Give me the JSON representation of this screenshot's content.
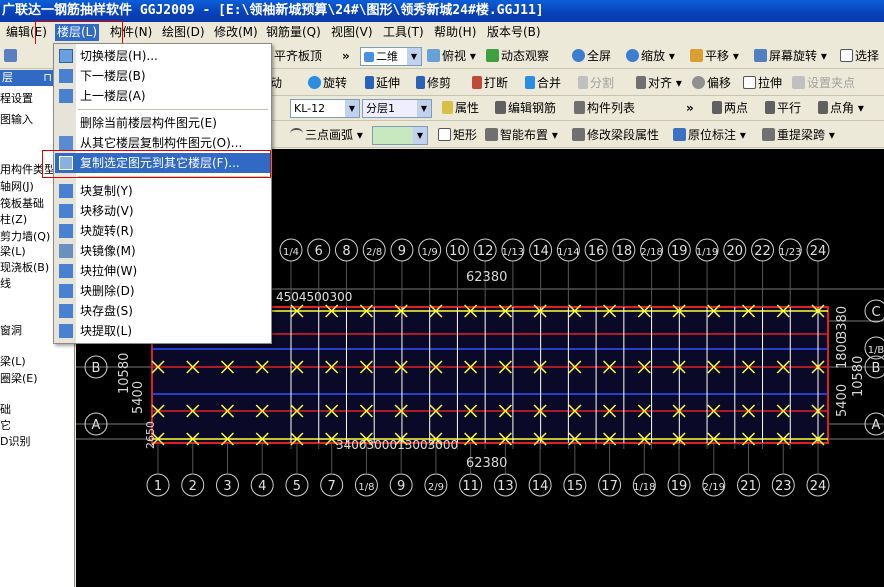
{
  "window": {
    "title": "广联达一钢筋抽样软件 GGJ2009 - [E:\\领袖新城预算\\24#\\图形\\领秀新城24#楼.GGJ11]"
  },
  "menubar": {
    "items": [
      "编辑(E)",
      "楼层(L)",
      "构件(N)",
      "绘图(D)",
      "修改(M)",
      "钢筋量(Q)",
      "视图(V)",
      "工具(T)",
      "帮助(H)",
      "版本号(B)"
    ]
  },
  "toolbar1": {
    "flat_slab": "平齐板顶",
    "view_mode": "二维",
    "view": "俯视",
    "dynamic": "动态观察",
    "fullscreen": "全屏",
    "zoom": "缩放",
    "pan": "平移",
    "rotate_screen": "屏幕旋转",
    "select": "选择"
  },
  "toolbar2": {
    "move": "移动",
    "rotate": "旋转",
    "extend": "延伸",
    "trim": "修剪",
    "break": "打断",
    "merge": "合并",
    "split": "分割",
    "align": "对齐",
    "offset": "偏移",
    "stretch": "拉伸",
    "set_point": "设置夹点"
  },
  "toolbar3": {
    "component": "KL-12",
    "layer": "分层1",
    "props": "属性",
    "edit_rebar": "编辑钢筋",
    "comp_list": "构件列表",
    "two_points": "两点",
    "parallel": "平行",
    "angle_point": "点角"
  },
  "toolbar4": {
    "arc": "三点画弧",
    "rect": "矩形",
    "smart": "智能布置",
    "modify_span": "修改梁段属性",
    "origin_mark": "原位标注",
    "rearrange": "重提梁跨"
  },
  "sidebar": {
    "items": [
      "层",
      "程设置",
      "图输入",
      "用构件类型",
      "轴网(J)",
      "筏板基础",
      "柱(Z)",
      "剪力墙(Q)",
      "梁(L)",
      "现浇板(B)",
      "线",
      "窗洞",
      "梁(L)",
      "圈梁(E)",
      "础",
      "它",
      "D识别"
    ]
  },
  "dropdown": {
    "items": [
      "切换楼层(H)...",
      "下一楼层(B)",
      "上一楼层(A)",
      "删除当前楼层构件图元(E)",
      "从其它楼层复制构件图元(O)...",
      "复制选定图元到其它楼层(F)...",
      "块复制(Y)",
      "块移动(V)",
      "块旋转(R)",
      "块镜像(M)",
      "块拉伸(W)",
      "块删除(D)",
      "块存盘(S)",
      "块提取(L)"
    ]
  },
  "drawing": {
    "top_axes": [
      "1/4",
      "6",
      "8",
      "2/8",
      "9",
      "1/9",
      "10",
      "12",
      "1/13",
      "14",
      "1/14",
      "16",
      "18",
      "2/18",
      "19",
      "1/19",
      "20",
      "22",
      "1/23",
      "24"
    ],
    "bottom_axes": [
      "1",
      "2",
      "3",
      "4",
      "5",
      "7",
      "1/8",
      "9",
      "2/9",
      "11",
      "13",
      "14",
      "15",
      "17",
      "1/18",
      "19",
      "2/19",
      "21",
      "23",
      "24"
    ],
    "left_axes": [
      "B",
      "A"
    ],
    "right_axes": [
      "C",
      "1/B",
      "B",
      "A"
    ],
    "total_dim": "62380",
    "left_dims": [
      "10580",
      "5400",
      "2650"
    ],
    "right_dims": [
      "10580",
      "5400",
      "1800",
      "3380"
    ],
    "top_segment_label": "4504500300",
    "bottom_segment_label": "3400300013003000"
  }
}
